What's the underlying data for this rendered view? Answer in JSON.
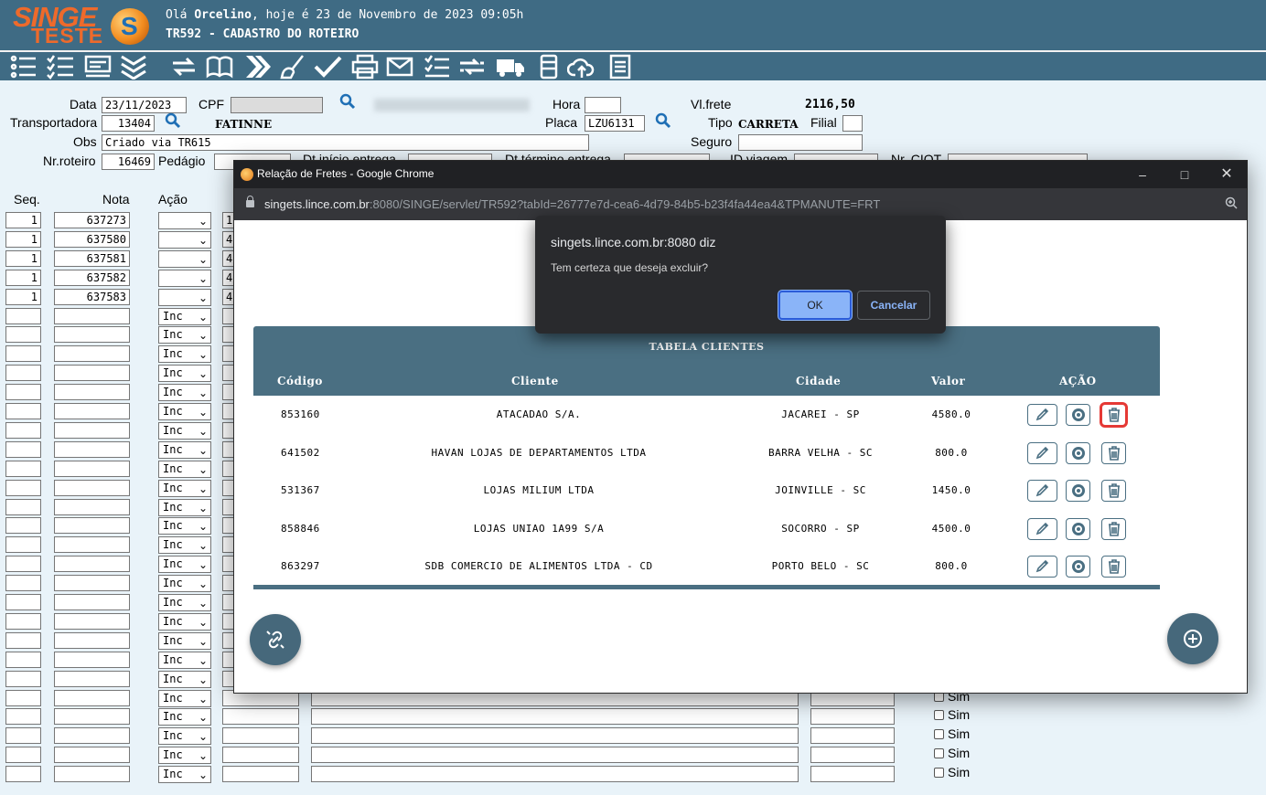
{
  "header": {
    "logo_line1": "SINGE",
    "logo_line2": "TESTE",
    "greeting_prefix": "Olá ",
    "user": "Orcelino",
    "greeting_suffix": ", hoje é 23 de Novembro de 2023 09:05h",
    "title": "TR592 - CADASTRO DO ROTEIRO"
  },
  "toolbar_icons": [
    "list-icon",
    "checklist-icon",
    "report-icon",
    "collapse-icon",
    "swap-icon",
    "book-icon",
    "forward-icon",
    "broom-icon",
    "check-icon",
    "print-icon",
    "email-icon",
    "task-list-icon",
    "transfer-icon",
    "truck-icon",
    "database-icon",
    "cloud-upload-icon",
    "notes-icon"
  ],
  "form": {
    "data_label": "Data",
    "data_value": "23/11/2023",
    "cpf_label": "CPF",
    "hora_label": "Hora",
    "hora_value": "",
    "vlfrete_label": "Vl.frete",
    "vlfrete_value": "2116,50",
    "transportadora_label": "Transportadora",
    "transportadora_code": "13404",
    "transportadora_name": "FATINNE",
    "placa_label": "Placa",
    "placa_value": "LZU6131",
    "tipo_label": "Tipo",
    "tipo_value": "CARRETA",
    "filial_label": "Filial",
    "filial_value": "",
    "obs_label": "Obs",
    "obs_value": "Criado via TR615",
    "seguro_label": "Seguro",
    "seguro_value": "",
    "nroteiro_label": "Nr.roteiro",
    "nroteiro_value": "16469",
    "pedagio_label": "Pedágio",
    "dt_inicio_label": "Dt.início entrega",
    "dt_termino_label": "Dt.término entrega",
    "id_viagem_label": "ID viagem",
    "nr_ciot_label": "Nr. CIOT"
  },
  "grid": {
    "col_seq": "Seq.",
    "col_nota": "Nota",
    "col_acao": "Ação",
    "inc_label": "Inc",
    "sim_label": "Sim",
    "filled_rows": [
      {
        "seq": "1",
        "nota": "637273",
        "next": "1"
      },
      {
        "seq": "1",
        "nota": "637580",
        "next": "4"
      },
      {
        "seq": "1",
        "nota": "637581",
        "next": "4"
      },
      {
        "seq": "1",
        "nota": "637582",
        "next": "4"
      },
      {
        "seq": "1",
        "nota": "637583",
        "next": "4"
      }
    ]
  },
  "popup": {
    "window_title": "Relação de Fretes - Google Chrome",
    "url_host": "singets.lince.com.br",
    "url_rest": ":8080/SINGE/servlet/TR592?tabId=26777e7d-cea6-4d79-84b5-b23f4fa44ea4&TPMANUTE=FRT",
    "table_title": "TABELA CLIENTES",
    "columns": {
      "codigo": "Código",
      "cliente": "Cliente",
      "cidade": "Cidade",
      "valor": "Valor",
      "acao": "AÇÃO"
    },
    "rows": [
      {
        "codigo": "853160",
        "cliente": "ATACADAO S/A.",
        "cidade": "JACAREI - SP",
        "valor": "4580.0"
      },
      {
        "codigo": "641502",
        "cliente": "HAVAN LOJAS DE DEPARTAMENTOS LTDA",
        "cidade": "BARRA VELHA - SC",
        "valor": "800.0"
      },
      {
        "codigo": "531367",
        "cliente": "LOJAS MILIUM LTDA",
        "cidade": "JOINVILLE - SC",
        "valor": "1450.0"
      },
      {
        "codigo": "858846",
        "cliente": "LOJAS UNIAO 1A99 S/A",
        "cidade": "SOCORRO - SP",
        "valor": "4500.0"
      },
      {
        "codigo": "863297",
        "cliente": "SDB COMERCIO DE ALIMENTOS LTDA - CD",
        "cidade": "PORTO BELO - SC",
        "valor": "800.0"
      }
    ]
  },
  "confirm": {
    "origin": "singets.lince.com.br:8080 diz",
    "message": "Tem certeza que deseja excluir?",
    "ok_label": "OK",
    "cancel_label": "Cancelar"
  },
  "colors": {
    "header_bg": "#3f6b84",
    "page_bg": "#e9f3f9",
    "table_header": "#4a6f82",
    "logo_orange": "#ee6a2b",
    "dialog_bg": "#292a2d",
    "ok_button": "#8ab4f8",
    "highlight": "#e53935"
  }
}
